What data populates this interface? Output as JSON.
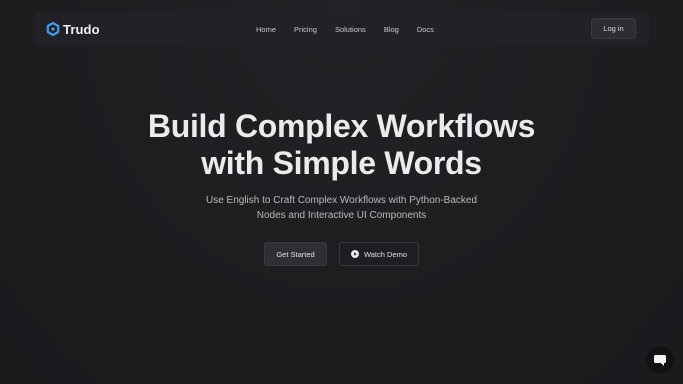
{
  "brand": {
    "name": "Trudo",
    "logo_icon": "hexagon-logo-icon",
    "accent_color": "#3b9cf0"
  },
  "nav": {
    "links": [
      "Home",
      "Pricing",
      "Solutions",
      "Blog",
      "Docs"
    ],
    "login_label": "Log in"
  },
  "hero": {
    "title_line1": "Build Complex Workflows",
    "title_line2": "with Simple Words",
    "subtitle_line1": "Use English to Craft Complex Workflows with Python-Backed",
    "subtitle_line2": "Nodes and Interactive UI Components"
  },
  "cta": {
    "primary_label": "Get Started",
    "secondary_label": "Watch Demo",
    "secondary_icon": "play-circle-icon"
  },
  "chat": {
    "icon": "chat-bubble-icon"
  }
}
